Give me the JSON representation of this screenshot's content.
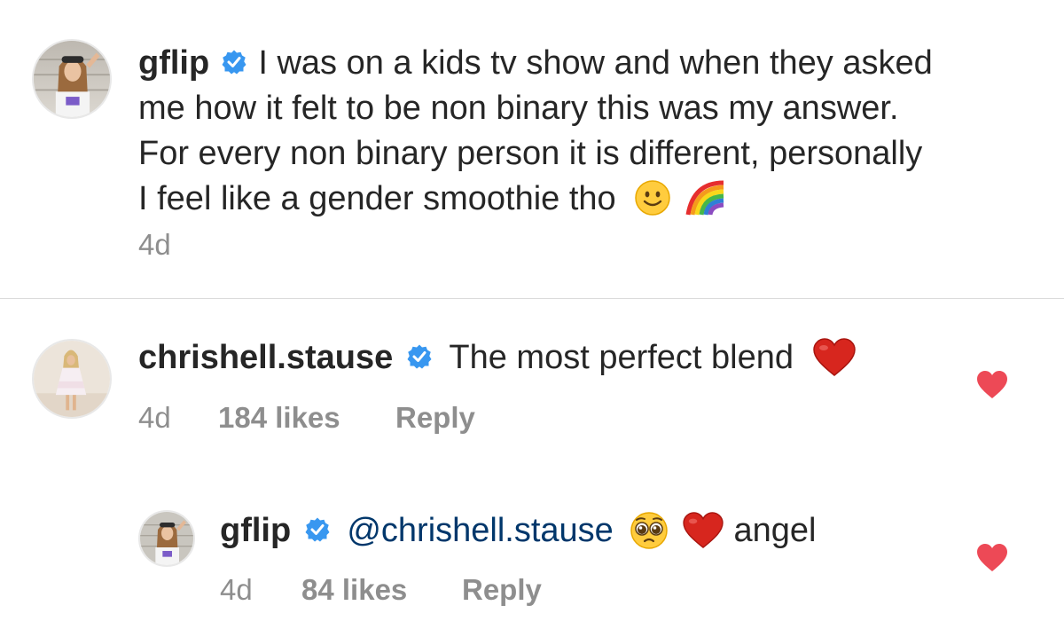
{
  "caption": {
    "username": "gflip",
    "text_line1": "I was on a kids tv show and when they asked",
    "text_line2": "me how it felt to be non binary this was my answer.",
    "text_line3": "For every non binary person it is different, personally",
    "text_line4": "I feel like a gender smoothie tho",
    "emojis": [
      "slightly-smiling-face-emoji",
      "rainbow-emoji"
    ],
    "time": "4d"
  },
  "comments": [
    {
      "username": "chrishell.stause",
      "text": "The most perfect blend",
      "emojis": [
        "red-heart-emoji"
      ],
      "time": "4d",
      "likes": "184 likes",
      "reply_label": "Reply"
    },
    {
      "username": "gflip",
      "mention": "@chrishell.stause",
      "text": "angel",
      "emojis": [
        "pleading-face-emoji",
        "red-heart-emoji"
      ],
      "time": "4d",
      "likes": "84 likes",
      "reply_label": "Reply"
    }
  ],
  "colors": {
    "text": "#262626",
    "meta": "#8e8e8e",
    "mention": "#00376b",
    "verified": "#3897f0",
    "like_heart": "#ed4956",
    "divider": "#dbdbdb"
  }
}
